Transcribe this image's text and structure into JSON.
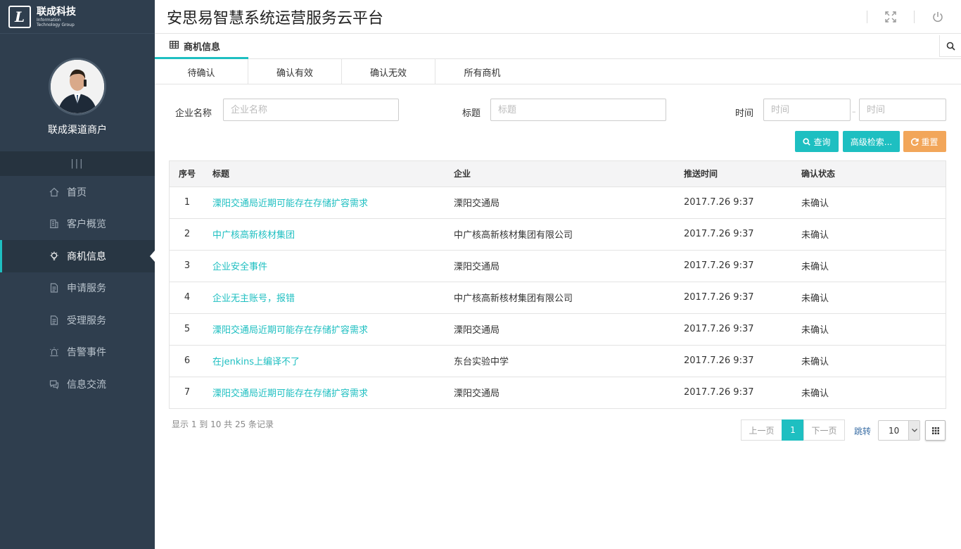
{
  "brand": {
    "logo_letter": "L",
    "name": "联成科技",
    "sub1": "Information",
    "sub2": "Technology Group"
  },
  "profile": {
    "name": "联成渠道商户"
  },
  "sidebar": {
    "collapse_glyph": "|||",
    "items": [
      {
        "label": "首页",
        "icon": "home-icon",
        "active": false
      },
      {
        "label": "客户概览",
        "icon": "building-icon",
        "active": false
      },
      {
        "label": "商机信息",
        "icon": "lightbulb-icon",
        "active": true
      },
      {
        "label": "申请服务",
        "icon": "document-icon",
        "active": false
      },
      {
        "label": "受理服务",
        "icon": "document-icon",
        "active": false
      },
      {
        "label": "告警事件",
        "icon": "alarm-icon",
        "active": false
      },
      {
        "label": "信息交流",
        "icon": "chat-icon",
        "active": false
      }
    ]
  },
  "header": {
    "title": "安思易智慧系统运营服务云平台"
  },
  "page_tab": {
    "label": "商机信息"
  },
  "subtabs": [
    "待确认",
    "确认有效",
    "确认无效",
    "所有商机"
  ],
  "filters": {
    "company_label": "企业名称",
    "company_placeholder": "企业名称",
    "title_label": "标题",
    "title_placeholder": "标题",
    "time_label": "时间",
    "time_start_placeholder": "时间",
    "time_end_placeholder": "时间",
    "time_separator": "–"
  },
  "buttons": {
    "query": "查询",
    "advanced": "高级检索...",
    "reset": "重置"
  },
  "table": {
    "headers": {
      "no": "序号",
      "title": "标题",
      "company": "企业",
      "time": "推送时间",
      "status": "确认状态"
    },
    "rows": [
      {
        "no": "1",
        "title": "溧阳交通局近期可能存在存储扩容需求",
        "company": "溧阳交通局",
        "time": "2017.7.26 9:37",
        "status": "未确认"
      },
      {
        "no": "2",
        "title": "中广核高新核材集团",
        "company": "中广核高新核材集团有限公司",
        "time": "2017.7.26 9:37",
        "status": "未确认"
      },
      {
        "no": "3",
        "title": "企业安全事件",
        "company": "溧阳交通局",
        "time": "2017.7.26 9:37",
        "status": "未确认"
      },
      {
        "no": "4",
        "title": "企业无主账号，报错",
        "company": "中广核高新核材集团有限公司",
        "time": "2017.7.26 9:37",
        "status": "未确认"
      },
      {
        "no": "5",
        "title": "溧阳交通局近期可能存在存储扩容需求",
        "company": "溧阳交通局",
        "time": "2017.7.26 9:37",
        "status": "未确认"
      },
      {
        "no": "6",
        "title": "在jenkins上编译不了",
        "company": "东台实验中学",
        "time": "2017.7.26 9:37",
        "status": "未确认"
      },
      {
        "no": "7",
        "title": "溧阳交通局近期可能存在存储扩容需求",
        "company": "溧阳交通局",
        "time": "2017.7.26 9:37",
        "status": "未确认"
      }
    ]
  },
  "footer": {
    "summary": "显示 1 到 10 共 25 条记录"
  },
  "pagination": {
    "prev": "上一页",
    "current": "1",
    "next": "下一页",
    "jump": "跳转",
    "page_size": "10"
  },
  "colors": {
    "sidebar": "#2f3e4e",
    "accent": "#1ebfc1",
    "reset": "#f2a65a"
  }
}
